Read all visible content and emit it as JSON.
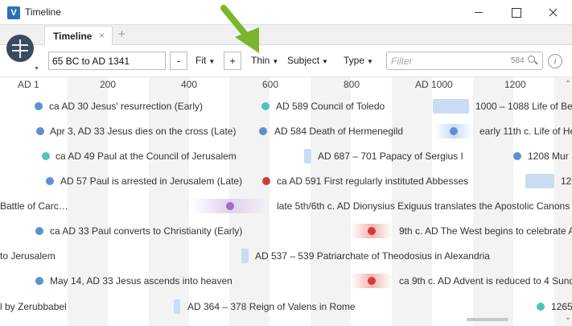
{
  "window": {
    "title": "Timeline",
    "app_icon": "logos-icon"
  },
  "tabs": [
    {
      "label": "Timeline",
      "close": "×"
    }
  ],
  "tab_add": "+",
  "toolbar": {
    "range_value": "65 BC to AD 1341",
    "minus_label": "-",
    "fit_label": "Fit",
    "plus_label": "+",
    "thin_label": "Thin",
    "subject_label": "Subject",
    "type_label": "Type",
    "filter_placeholder": "Filter",
    "filter_count": "584",
    "info_label": "i"
  },
  "axis": {
    "ticks": [
      "AD 1",
      "200",
      "400",
      "600",
      "800",
      "AD 1000",
      "1200"
    ]
  },
  "colors": {
    "blue": "#5b8fd6",
    "teal": "#4dc3c0",
    "red": "#d43a3a",
    "purple": "#9b6fc4",
    "arrow": "#7bb52b"
  },
  "events": {
    "r1": [
      "ca AD 30   Jesus' resurrection (Early)",
      "AD 589   Council of Toledo",
      "1000 – 1088   Life of Bere"
    ],
    "r2": [
      "Apr 3, AD 33   Jesus dies on the cross (Late)",
      "AD 584   Death of Hermenegild",
      "early 11th c.   Life of He"
    ],
    "r3": [
      "ca AD 49   Paul at the Council of Jerusalem",
      "AD 687 – 701   Papacy of Sergius I",
      "1208   Mur"
    ],
    "r4": [
      "AD 57   Paul is arrested in Jerusalem (Late)",
      "ca AD 591   First regularly instituted Abbesses",
      "12"
    ],
    "r5": [
      "Battle of Carc…",
      "late 5th/6th c. AD   Dionysius Exiguus translates the Apostolic Canons fr"
    ],
    "r6": [
      "ca AD 33   Paul converts to Christianity (Early)",
      "9th c. AD   The West begins to celebrate A"
    ],
    "r7": [
      "to Jerusalem",
      "AD 537 – 539   Patriarchate of Theodosius in Alexandria"
    ],
    "r8": [
      "May 14, AD 33   Jesus ascends into heaven",
      "ca 9th c. AD   Advent is reduced to 4 Sund"
    ],
    "r9": [
      "l by Zerubbabel",
      "AD 364 – 378   Reign of Valens in Rome",
      "1265"
    ]
  }
}
